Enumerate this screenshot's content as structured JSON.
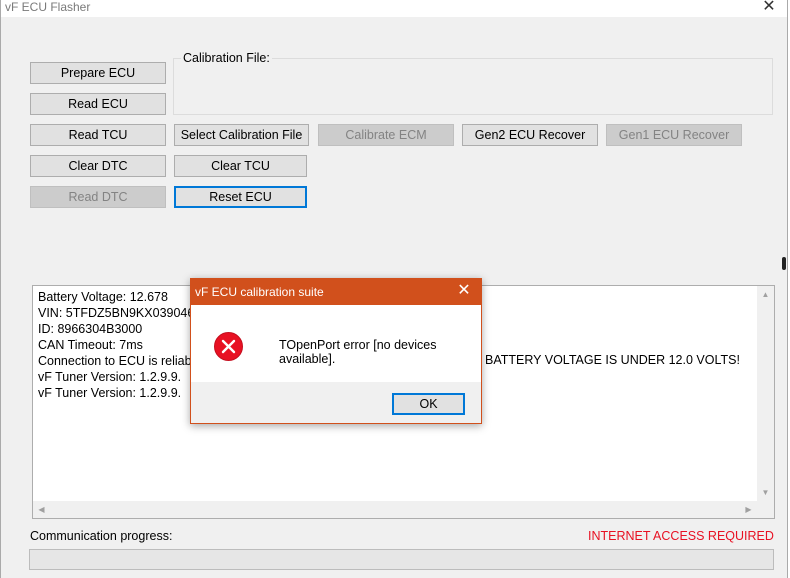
{
  "window": {
    "title": "vF ECU Flasher",
    "close_glyph": "✕"
  },
  "buttons": {
    "prepare_ecu": "Prepare ECU",
    "read_ecu": "Read ECU",
    "read_tcu": "Read TCU",
    "clear_dtc": "Clear DTC",
    "read_dtc": "Read DTC",
    "select_calibration_file": "Select Calibration File",
    "clear_tcu": "Clear TCU",
    "reset_ecu": "Reset ECU",
    "calibrate_ecm": "Calibrate ECM",
    "gen2_ecu_recover": "Gen2 ECU Recover",
    "gen1_ecu_recover": "Gen1 ECU Recover"
  },
  "calibration": {
    "label": "Calibration File:"
  },
  "log": {
    "lines": [
      "Battery Voltage: 12.678",
      "VIN: 5TFDZ5BN9KX039046",
      "ID: 8966304B3000",
      "CAN Timeout: 7ms",
      "Connection to ECU is reliab",
      "vF Tuner Version: 1.2.9.9.",
      "vF Tuner Version: 1.2.9.9."
    ],
    "overflow_text": "BATTERY VOLTAGE IS UNDER 12.0 VOLTS!"
  },
  "footer": {
    "progress_label": "Communication progress:",
    "internet_notice": "INTERNET ACCESS REQUIRED",
    "progress_value": 0
  },
  "dialog": {
    "title": "vF ECU calibration suite",
    "message": "TOpenPort error [no devices available].",
    "ok_label": "OK",
    "close_glyph": "✕"
  },
  "colors": {
    "dialog_accent": "#d1501c",
    "error_red": "#e81123",
    "focus_blue": "#0078d7"
  },
  "icons": {
    "dialog_icon": "error-icon"
  }
}
